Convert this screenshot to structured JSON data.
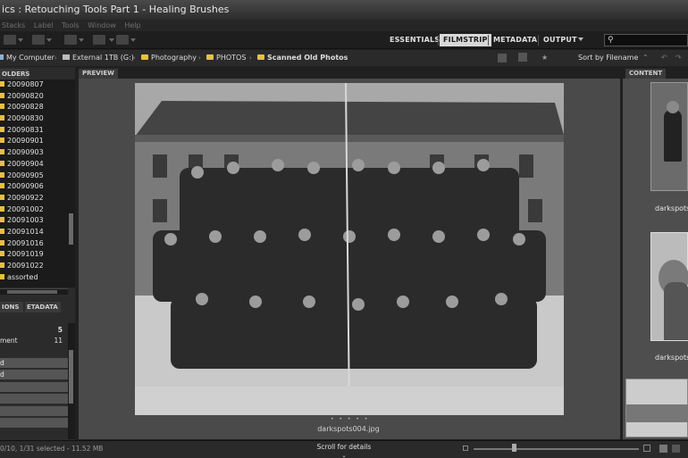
{
  "window": {
    "title": "ics : Retouching Tools Part 1 - Healing Brushes"
  },
  "menu": [
    "Stacks",
    "Label",
    "Tools",
    "Window",
    "Help"
  ],
  "workspaces": {
    "tabs": [
      "ESSENTIALS",
      "FILMSTRIP",
      "METADATA",
      "OUTPUT"
    ],
    "active": "FILMSTRIP"
  },
  "path": {
    "crumbs": [
      "My Computer",
      "External 1TB (G:)",
      "Photography",
      "PHOTOS",
      "Scanned Old Photos"
    ],
    "sort_label": "Sort by Filename"
  },
  "left_panel": {
    "folders_tab": "OLDERS",
    "folders": [
      "20090807",
      "20090820",
      "20090828",
      "20090830",
      "20090831",
      "20090901",
      "20090903",
      "20090904",
      "20090905",
      "20090906",
      "20090922",
      "20091002",
      "20091003",
      "20091014",
      "20091016",
      "20091019",
      "20091022",
      "assorted"
    ],
    "lower_tabs": [
      "IONS",
      "ETADATA"
    ],
    "filter_rows": [
      {
        "label": "",
        "count": "5"
      },
      {
        "label": "ment",
        "count": "11"
      }
    ],
    "filter_bars": [
      "d",
      "d",
      "",
      "",
      "",
      ""
    ]
  },
  "preview": {
    "tab": "PREVIEW",
    "filename": "darkspots004.jpg",
    "dots": "• • • • •"
  },
  "content": {
    "tab": "CONTENT",
    "captions": [
      "darkspots",
      "darkspots"
    ]
  },
  "status": {
    "text": "0/10, 1/31 selected - 11.52 MB",
    "scroll_hint": "Scroll for details"
  },
  "colors": {
    "active_tab_bg": "#d8d8d8",
    "folder_icon": "#e8c040",
    "panel_bg": "#2b2b2b"
  }
}
